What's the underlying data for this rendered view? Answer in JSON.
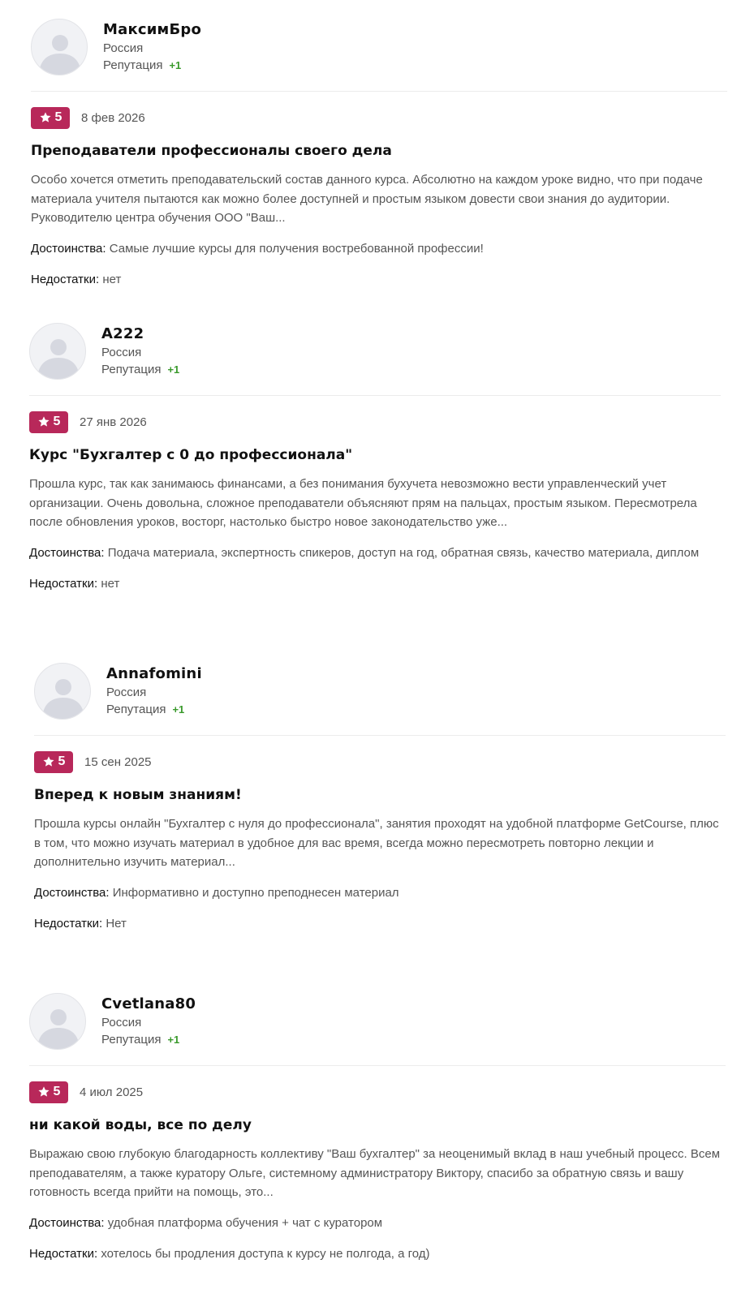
{
  "reviews": [
    {
      "author": "МаксимБро",
      "country": "Россия",
      "reputation_label": "Репутация",
      "reputation_value": "+1",
      "rating": "5",
      "date": "8 фев 2026",
      "title": "Преподаватели профессионалы своего дела",
      "text": "Особо хочется отметить преподавательский состав данного курса. Абсолютно на каждом уроке видно, что при подаче материала учителя пытаются как можно более доступней и простым языком довести свои знания до аудитории. Руководителю центра обучения ООО \"Ваш...",
      "pros_label": "Достоинства:",
      "pros": "Самые лучшие курсы для получения востребованной профессии!",
      "cons_label": "Недостатки:",
      "cons": "нет"
    },
    {
      "author": "A222",
      "country": "Россия",
      "reputation_label": "Репутация",
      "reputation_value": "+1",
      "rating": "5",
      "date": "27 янв 2026",
      "title": "Курс \"Бухгалтер с 0 до профессионала\"",
      "text": "Прошла курс, так как занимаюсь финансами, а без понимания бухучета невозможно вести управленческий учет организации. Очень довольна, сложное преподаватели объясняют прям на пальцах, простым языком. Пересмотрела после обновления уроков, восторг, настолько быстро новое законодательство уже...",
      "pros_label": "Достоинства:",
      "pros": "Подача материала, экспертность спикеров, доступ на год, обратная связь, качество материала, диплом",
      "cons_label": "Недостатки:",
      "cons": "нет"
    },
    {
      "author": "Annafomini",
      "country": "Россия",
      "reputation_label": "Репутация",
      "reputation_value": "+1",
      "rating": "5",
      "date": "15 сен 2025",
      "title": "Вперед к новым знаниям!",
      "text": "Прошла курсы онлайн \"Бухгалтер с нуля до профессионала\", занятия проходят на удобной платформе GetCourse, плюс в том, что можно изучать материал в удобное для вас время, всегда можно пересмотреть повторно лекции и дополнительно изучить материал...",
      "pros_label": "Достоинства:",
      "pros": "Информативно и доступно преподнесен материал",
      "cons_label": "Недостатки:",
      "cons": "Нет"
    },
    {
      "author": "Cvetlana80",
      "country": "Россия",
      "reputation_label": "Репутация",
      "reputation_value": "+1",
      "rating": "5",
      "date": "4 июл 2025",
      "title": "ни какой воды, все по делу",
      "text": "Выражаю свою глубокую благодарность коллективу \"Ваш бухгалтер\" за неоценимый вклад в наш учебный процесс. Всем преподавателям, а также куратору Ольге, системному администратору Виктору, спасибо за обратную связь и вашу готовность всегда прийти на помощь, это...",
      "pros_label": "Достоинства:",
      "pros": "удобная платформа обучения + чат с куратором",
      "cons_label": "Недостатки:",
      "cons": "хотелось бы продления доступа к курсу не полгода, а год)"
    }
  ],
  "colors": {
    "badge": "#b8285a",
    "reputation": "#3a9a2c",
    "muted_text": "#555555",
    "divider": "#ececec"
  }
}
